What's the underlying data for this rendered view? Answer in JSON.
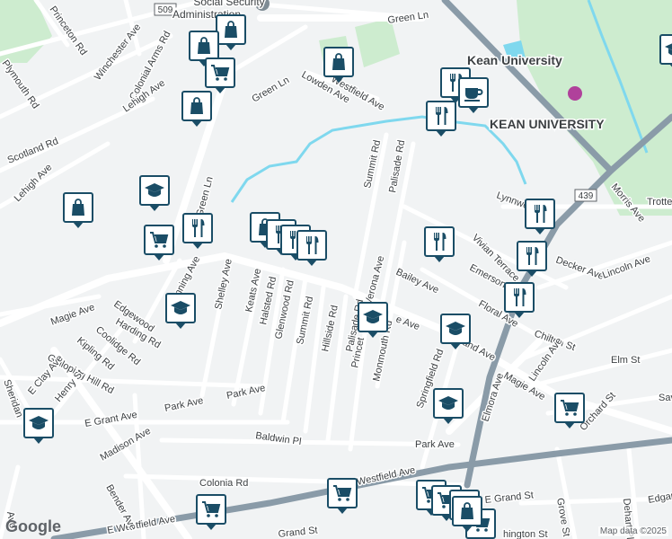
{
  "colors": {
    "background": "#f1f3f4",
    "road": "#ffffff",
    "major_road": "#8a9ba8",
    "green": "#cdeccf",
    "water": "#7fd8ee",
    "marker_border": "#1a4d66"
  },
  "labels": {
    "social_security": "Social Security",
    "administration": "Administration",
    "kean_university": "Kean University",
    "kean_university_caps": "KEAN UNIVERSITY",
    "route_509": "509",
    "route_439": "439",
    "green_ln_top": "Green Ln",
    "green_ln_mid": "Green Ln",
    "green_ln_left": "Green Ln",
    "princeton_rd": "Princeton Rd",
    "plymouth_rd": "Plymouth Rd",
    "winchester_ave": "Winchester Ave",
    "colonial_arms_rd": "Colonial Arms Rd",
    "lehigh_ave_top": "Lehigh Ave",
    "lehigh_ave_left": "Lehigh Ave",
    "scotland_rd": "Scotland Rd",
    "lowden_ave": "Lowden Ave",
    "westfield_ave_top": "Westfield Ave",
    "summit_rd_top": "Summit Rd",
    "palisade_rd_top": "Palisade Rd",
    "verona_ave": "Verona Ave",
    "bailey_ave": "Bailey Ave",
    "lynnwood": "Lynnwood",
    "vivian_terrace": "Vivian Terrace",
    "decker_ave": "Decker Ave",
    "lincoln_ave_right": "Lincoln Ave",
    "morris_ave": "Morris Ave",
    "trotter": "Trotter",
    "emerson": "Emerson",
    "floral_ave": "Floral Ave",
    "chilton_st": "Chilton St",
    "lincoln_ave": "Lincoln Ave",
    "elm_st": "Elm St",
    "elmora_ave": "Elmora Ave",
    "magie_ave_right": "Magie Ave",
    "orchard_st": "Orchard St",
    "sav": "Sav",
    "magie_ave_left": "Magie Ave",
    "edgewood": "Edgewood",
    "manning_ave": "nning Ave",
    "shelley_ave": "Shelley Ave",
    "keats_ave": "Keats Ave",
    "halsted_rd": "Halsted Rd",
    "glenwood_rd": "Glenwood Rd",
    "summit_rd": "Summit Rd",
    "hillside_rd": "Hillside Rd",
    "palisade_rd": "Palisade Rd",
    "princeton": "Princet",
    "monmouth_rd": "Monmouth Rd",
    "springfield_rd": "Springfield Rd",
    "land_ave": "land Ave",
    "e_ave": "e Ave",
    "harding_rd": "Harding Rd",
    "coolidge_rd": "Coolidge Rd",
    "kipling_rd": "Kipling Rd",
    "galloping_hill_rd": "Galloping Hill Rd",
    "e_clay_ave": "E Clay Ave",
    "henry_st": "Henry St",
    "sheridan": "Sheridan",
    "park_ave": "Park Ave",
    "park_ave_right": "Park Ave",
    "e_grant_ave": "E Grant Ave",
    "madison_ave": "Madison Ave",
    "baldwin_pl": "Baldwin Pl",
    "colonia_rd": "Colonia Rd",
    "westfield_ave": "Westfield Ave",
    "e_westfield_ave": "E Westfield Ave",
    "bender_ave": "Bender Ave",
    "grand_st": "Grand St",
    "e_grand_st": "E Grand St",
    "grove_st": "Grove St",
    "dehart_pl": "Dehart Pl",
    "edgar": "Edgar",
    "washington": "hington St",
    "avon": "Avo"
  },
  "markers": [
    {
      "name": "shopping-marker",
      "icon": "bag"
    },
    {
      "name": "shopping-marker",
      "icon": "bag"
    },
    {
      "name": "grocery-marker",
      "icon": "cart"
    },
    {
      "name": "shopping-marker",
      "icon": "bag"
    },
    {
      "name": "shopping-marker",
      "icon": "bag"
    },
    {
      "name": "restaurant-marker",
      "icon": "fork-knife"
    },
    {
      "name": "cafe-marker",
      "icon": "cup"
    },
    {
      "name": "restaurant-marker",
      "icon": "fork-knife"
    },
    {
      "name": "school-marker",
      "icon": "cap"
    },
    {
      "name": "shopping-marker",
      "icon": "bag"
    },
    {
      "name": "restaurant-marker",
      "icon": "fork-knife"
    },
    {
      "name": "grocery-marker",
      "icon": "cart"
    },
    {
      "name": "shopping-marker",
      "icon": "bag"
    },
    {
      "name": "restaurant-marker",
      "icon": "fork-knife"
    },
    {
      "name": "restaurant-marker",
      "icon": "fork-knife"
    },
    {
      "name": "restaurant-marker",
      "icon": "fork-knife"
    },
    {
      "name": "restaurant-marker",
      "icon": "fork-knife"
    },
    {
      "name": "restaurant-marker",
      "icon": "fork-knife"
    },
    {
      "name": "restaurant-marker",
      "icon": "fork-knife"
    },
    {
      "name": "restaurant-marker",
      "icon": "fork-knife"
    },
    {
      "name": "school-marker",
      "icon": "cap"
    },
    {
      "name": "school-marker",
      "icon": "cap"
    },
    {
      "name": "school-marker",
      "icon": "cap"
    },
    {
      "name": "school-marker",
      "icon": "cap"
    },
    {
      "name": "school-marker",
      "icon": "cap"
    },
    {
      "name": "grocery-marker",
      "icon": "cart"
    },
    {
      "name": "grocery-marker",
      "icon": "cart"
    },
    {
      "name": "grocery-marker",
      "icon": "cart"
    },
    {
      "name": "grocery-marker",
      "icon": "cart"
    },
    {
      "name": "grocery-marker",
      "icon": "cart"
    },
    {
      "name": "grocery-marker",
      "icon": "cart"
    },
    {
      "name": "shopping-marker",
      "icon": "bag"
    },
    {
      "name": "grocery-marker",
      "icon": "cart"
    },
    {
      "name": "shopping-marker",
      "icon": "bag"
    }
  ],
  "attribution": {
    "logo": "Google",
    "copyright": "Map data ©2025"
  }
}
